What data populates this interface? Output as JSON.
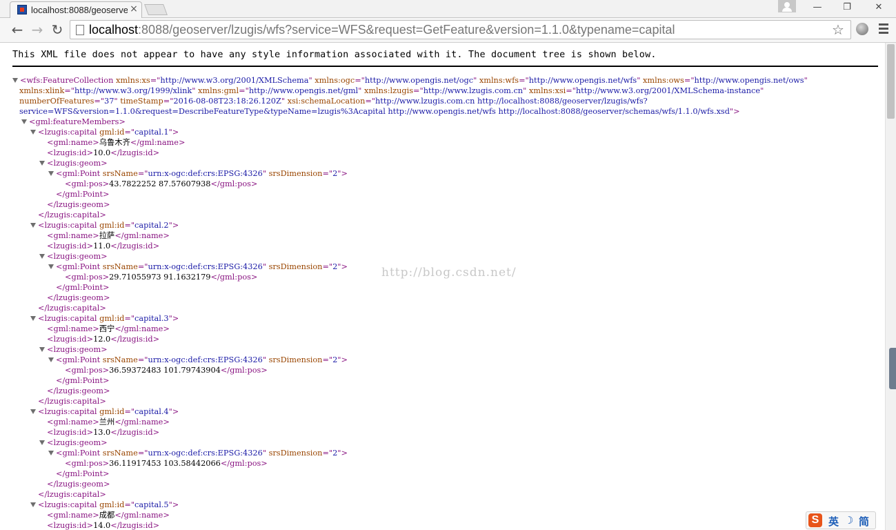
{
  "tab": {
    "title": "localhost:8088/geoserve",
    "close_glyph": "×"
  },
  "window_controls": {
    "minimize": "—",
    "restore": "❐",
    "close": "✕"
  },
  "toolbar": {
    "url_host": "localhost",
    "url_rest": ":8088/geoserver/lzugis/wfs?service=WFS&request=GetFeature&version=1.1.0&typename=capital",
    "back_glyph": "←",
    "forward_glyph": "→",
    "reload_glyph": "↻",
    "star_glyph": "☆"
  },
  "info_text": "This XML file does not appear to have any style information associated with it. The document tree is shown below.",
  "watermark": "http://blog.csdn.net/",
  "ime": {
    "logo": "S",
    "lang": "英",
    "moon": "☽",
    "mode": "简"
  },
  "icons": [
    "favicon-icon",
    "close-icon",
    "new-tab-icon",
    "user-icon",
    "back-icon",
    "forward-icon",
    "reload-icon",
    "page-icon",
    "star-icon",
    "extension-icon",
    "menu-icon",
    "collapse-arrow-icon",
    "ime-logo-icon"
  ],
  "xml_lines": [
    {
      "d": 0,
      "a": 1,
      "p": [
        [
          "t",
          "<wfs:FeatureCollection "
        ],
        [
          "n",
          "xmlns:xs"
        ],
        [
          "t",
          "=\""
        ],
        [
          "v",
          "http://www.w3.org/2001/XMLSchema"
        ],
        [
          "t",
          "\" "
        ],
        [
          "n",
          "xmlns:ogc"
        ],
        [
          "t",
          "=\""
        ],
        [
          "v",
          "http://www.opengis.net/ogc"
        ],
        [
          "t",
          "\" "
        ],
        [
          "n",
          "xmlns:wfs"
        ],
        [
          "t",
          "=\""
        ],
        [
          "v",
          "http://www.opengis.net/wfs"
        ],
        [
          "t",
          "\" "
        ],
        [
          "n",
          "xmlns:ows"
        ],
        [
          "t",
          "=\""
        ],
        [
          "v",
          "http://www.opengis.net/ows"
        ],
        [
          "t",
          "\""
        ]
      ]
    },
    {
      "d": 0,
      "a": 0,
      "w": 1,
      "p": [
        [
          "n",
          "xmlns:xlink"
        ],
        [
          "t",
          "=\""
        ],
        [
          "v",
          "http://www.w3.org/1999/xlink"
        ],
        [
          "t",
          "\" "
        ],
        [
          "n",
          "xmlns:gml"
        ],
        [
          "t",
          "=\""
        ],
        [
          "v",
          "http://www.opengis.net/gml"
        ],
        [
          "t",
          "\" "
        ],
        [
          "n",
          "xmlns:lzugis"
        ],
        [
          "t",
          "=\""
        ],
        [
          "v",
          "http://www.lzugis.com.cn"
        ],
        [
          "t",
          "\" "
        ],
        [
          "n",
          "xmlns:xsi"
        ],
        [
          "t",
          "=\""
        ],
        [
          "v",
          "http://www.w3.org/2001/XMLSchema-instance"
        ],
        [
          "t",
          "\""
        ]
      ]
    },
    {
      "d": 0,
      "a": 0,
      "w": 1,
      "p": [
        [
          "n",
          "numberOfFeatures"
        ],
        [
          "t",
          "=\""
        ],
        [
          "v",
          "37"
        ],
        [
          "t",
          "\" "
        ],
        [
          "n",
          "timeStamp"
        ],
        [
          "t",
          "=\""
        ],
        [
          "v",
          "2016-08-08T23:18:26.120Z"
        ],
        [
          "t",
          "\" "
        ],
        [
          "n",
          "xsi:schemaLocation"
        ],
        [
          "t",
          "=\""
        ],
        [
          "v",
          "http://www.lzugis.com.cn http://localhost:8088/geoserver/lzugis/wfs?"
        ]
      ]
    },
    {
      "d": 0,
      "a": 0,
      "w": 1,
      "p": [
        [
          "v",
          "service=WFS&version=1.1.0&request=DescribeFeatureType&typeName=lzugis%3Acapital http://www.opengis.net/wfs http://localhost:8088/geoserver/schemas/wfs/1.1.0/wfs.xsd"
        ],
        [
          "t",
          "\">"
        ]
      ]
    },
    {
      "d": 1,
      "a": 1,
      "p": [
        [
          "t",
          "<gml:featureMembers>"
        ]
      ]
    },
    {
      "d": 2,
      "a": 1,
      "p": [
        [
          "t",
          "<lzugis:capital "
        ],
        [
          "n",
          "gml:id"
        ],
        [
          "t",
          "=\""
        ],
        [
          "v",
          "capital.1"
        ],
        [
          "t",
          "\">"
        ]
      ]
    },
    {
      "d": 3,
      "a": 0,
      "p": [
        [
          "t",
          "<gml:name>"
        ],
        [
          "x",
          "乌鲁木齐"
        ],
        [
          "t",
          "</gml:name>"
        ]
      ]
    },
    {
      "d": 3,
      "a": 0,
      "p": [
        [
          "t",
          "<lzugis:id>"
        ],
        [
          "x",
          "10.0"
        ],
        [
          "t",
          "</lzugis:id>"
        ]
      ]
    },
    {
      "d": 3,
      "a": 1,
      "p": [
        [
          "t",
          "<lzugis:geom>"
        ]
      ]
    },
    {
      "d": 4,
      "a": 1,
      "p": [
        [
          "t",
          "<gml:Point "
        ],
        [
          "n",
          "srsName"
        ],
        [
          "t",
          "=\""
        ],
        [
          "v",
          "urn:x-ogc:def:crs:EPSG:4326"
        ],
        [
          "t",
          "\" "
        ],
        [
          "n",
          "srsDimension"
        ],
        [
          "t",
          "=\""
        ],
        [
          "v",
          "2"
        ],
        [
          "t",
          "\">"
        ]
      ]
    },
    {
      "d": 5,
      "a": 0,
      "p": [
        [
          "t",
          "<gml:pos>"
        ],
        [
          "x",
          "43.7822252 87.57607938"
        ],
        [
          "t",
          "</gml:pos>"
        ]
      ]
    },
    {
      "d": 4,
      "a": 0,
      "p": [
        [
          "t",
          "</gml:Point>"
        ]
      ]
    },
    {
      "d": 3,
      "a": 0,
      "p": [
        [
          "t",
          "</lzugis:geom>"
        ]
      ]
    },
    {
      "d": 2,
      "a": 0,
      "p": [
        [
          "t",
          "</lzugis:capital>"
        ]
      ]
    },
    {
      "d": 2,
      "a": 1,
      "p": [
        [
          "t",
          "<lzugis:capital "
        ],
        [
          "n",
          "gml:id"
        ],
        [
          "t",
          "=\""
        ],
        [
          "v",
          "capital.2"
        ],
        [
          "t",
          "\">"
        ]
      ]
    },
    {
      "d": 3,
      "a": 0,
      "p": [
        [
          "t",
          "<gml:name>"
        ],
        [
          "x",
          "拉萨"
        ],
        [
          "t",
          "</gml:name>"
        ]
      ]
    },
    {
      "d": 3,
      "a": 0,
      "p": [
        [
          "t",
          "<lzugis:id>"
        ],
        [
          "x",
          "11.0"
        ],
        [
          "t",
          "</lzugis:id>"
        ]
      ]
    },
    {
      "d": 3,
      "a": 1,
      "p": [
        [
          "t",
          "<lzugis:geom>"
        ]
      ]
    },
    {
      "d": 4,
      "a": 1,
      "p": [
        [
          "t",
          "<gml:Point "
        ],
        [
          "n",
          "srsName"
        ],
        [
          "t",
          "=\""
        ],
        [
          "v",
          "urn:x-ogc:def:crs:EPSG:4326"
        ],
        [
          "t",
          "\" "
        ],
        [
          "n",
          "srsDimension"
        ],
        [
          "t",
          "=\""
        ],
        [
          "v",
          "2"
        ],
        [
          "t",
          "\">"
        ]
      ]
    },
    {
      "d": 5,
      "a": 0,
      "p": [
        [
          "t",
          "<gml:pos>"
        ],
        [
          "x",
          "29.71055973 91.1632179"
        ],
        [
          "t",
          "</gml:pos>"
        ]
      ]
    },
    {
      "d": 4,
      "a": 0,
      "p": [
        [
          "t",
          "</gml:Point>"
        ]
      ]
    },
    {
      "d": 3,
      "a": 0,
      "p": [
        [
          "t",
          "</lzugis:geom>"
        ]
      ]
    },
    {
      "d": 2,
      "a": 0,
      "p": [
        [
          "t",
          "</lzugis:capital>"
        ]
      ]
    },
    {
      "d": 2,
      "a": 1,
      "p": [
        [
          "t",
          "<lzugis:capital "
        ],
        [
          "n",
          "gml:id"
        ],
        [
          "t",
          "=\""
        ],
        [
          "v",
          "capital.3"
        ],
        [
          "t",
          "\">"
        ]
      ]
    },
    {
      "d": 3,
      "a": 0,
      "p": [
        [
          "t",
          "<gml:name>"
        ],
        [
          "x",
          "西宁"
        ],
        [
          "t",
          "</gml:name>"
        ]
      ]
    },
    {
      "d": 3,
      "a": 0,
      "p": [
        [
          "t",
          "<lzugis:id>"
        ],
        [
          "x",
          "12.0"
        ],
        [
          "t",
          "</lzugis:id>"
        ]
      ]
    },
    {
      "d": 3,
      "a": 1,
      "p": [
        [
          "t",
          "<lzugis:geom>"
        ]
      ]
    },
    {
      "d": 4,
      "a": 1,
      "p": [
        [
          "t",
          "<gml:Point "
        ],
        [
          "n",
          "srsName"
        ],
        [
          "t",
          "=\""
        ],
        [
          "v",
          "urn:x-ogc:def:crs:EPSG:4326"
        ],
        [
          "t",
          "\" "
        ],
        [
          "n",
          "srsDimension"
        ],
        [
          "t",
          "=\""
        ],
        [
          "v",
          "2"
        ],
        [
          "t",
          "\">"
        ]
      ]
    },
    {
      "d": 5,
      "a": 0,
      "p": [
        [
          "t",
          "<gml:pos>"
        ],
        [
          "x",
          "36.59372483 101.79743904"
        ],
        [
          "t",
          "</gml:pos>"
        ]
      ]
    },
    {
      "d": 4,
      "a": 0,
      "p": [
        [
          "t",
          "</gml:Point>"
        ]
      ]
    },
    {
      "d": 3,
      "a": 0,
      "p": [
        [
          "t",
          "</lzugis:geom>"
        ]
      ]
    },
    {
      "d": 2,
      "a": 0,
      "p": [
        [
          "t",
          "</lzugis:capital>"
        ]
      ]
    },
    {
      "d": 2,
      "a": 1,
      "p": [
        [
          "t",
          "<lzugis:capital "
        ],
        [
          "n",
          "gml:id"
        ],
        [
          "t",
          "=\""
        ],
        [
          "v",
          "capital.4"
        ],
        [
          "t",
          "\">"
        ]
      ]
    },
    {
      "d": 3,
      "a": 0,
      "p": [
        [
          "t",
          "<gml:name>"
        ],
        [
          "x",
          "兰州"
        ],
        [
          "t",
          "</gml:name>"
        ]
      ]
    },
    {
      "d": 3,
      "a": 0,
      "p": [
        [
          "t",
          "<lzugis:id>"
        ],
        [
          "x",
          "13.0"
        ],
        [
          "t",
          "</lzugis:id>"
        ]
      ]
    },
    {
      "d": 3,
      "a": 1,
      "p": [
        [
          "t",
          "<lzugis:geom>"
        ]
      ]
    },
    {
      "d": 4,
      "a": 1,
      "p": [
        [
          "t",
          "<gml:Point "
        ],
        [
          "n",
          "srsName"
        ],
        [
          "t",
          "=\""
        ],
        [
          "v",
          "urn:x-ogc:def:crs:EPSG:4326"
        ],
        [
          "t",
          "\" "
        ],
        [
          "n",
          "srsDimension"
        ],
        [
          "t",
          "=\""
        ],
        [
          "v",
          "2"
        ],
        [
          "t",
          "\">"
        ]
      ]
    },
    {
      "d": 5,
      "a": 0,
      "p": [
        [
          "t",
          "<gml:pos>"
        ],
        [
          "x",
          "36.11917453 103.58442066"
        ],
        [
          "t",
          "</gml:pos>"
        ]
      ]
    },
    {
      "d": 4,
      "a": 0,
      "p": [
        [
          "t",
          "</gml:Point>"
        ]
      ]
    },
    {
      "d": 3,
      "a": 0,
      "p": [
        [
          "t",
          "</lzugis:geom>"
        ]
      ]
    },
    {
      "d": 2,
      "a": 0,
      "p": [
        [
          "t",
          "</lzugis:capital>"
        ]
      ]
    },
    {
      "d": 2,
      "a": 1,
      "p": [
        [
          "t",
          "<lzugis:capital "
        ],
        [
          "n",
          "gml:id"
        ],
        [
          "t",
          "=\""
        ],
        [
          "v",
          "capital.5"
        ],
        [
          "t",
          "\">"
        ]
      ]
    },
    {
      "d": 3,
      "a": 0,
      "p": [
        [
          "t",
          "<gml:name>"
        ],
        [
          "x",
          "成都"
        ],
        [
          "t",
          "</gml:name>"
        ]
      ]
    },
    {
      "d": 3,
      "a": 0,
      "p": [
        [
          "t",
          "<lzugis:id>"
        ],
        [
          "x",
          "14.0"
        ],
        [
          "t",
          "</lzugis:id>"
        ]
      ]
    }
  ]
}
